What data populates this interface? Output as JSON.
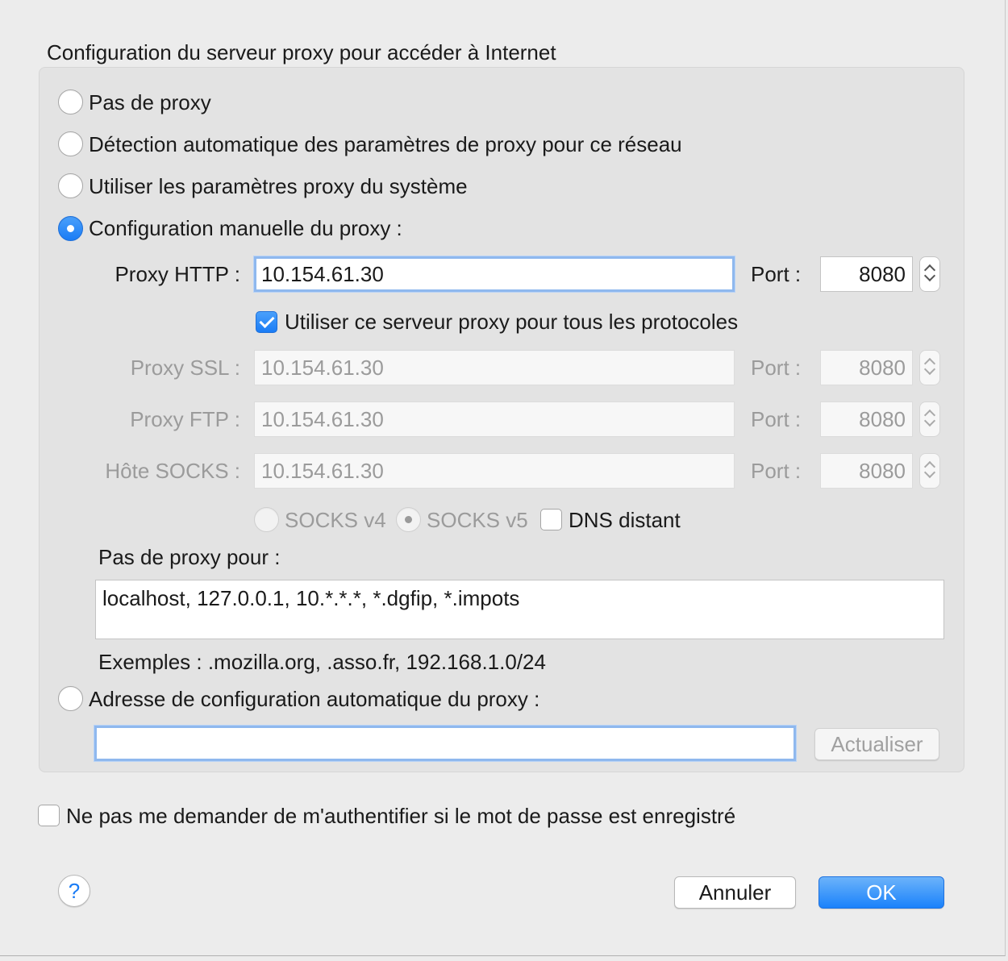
{
  "group": {
    "title": "Configuration du serveur proxy pour accéder à Internet"
  },
  "options": {
    "no_proxy": "Pas de proxy",
    "auto_detect": "Détection automatique des paramètres de proxy pour ce réseau",
    "system": "Utiliser les paramètres proxy du système",
    "manual": "Configuration manuelle du proxy :",
    "pac": "Adresse de configuration automatique du proxy :"
  },
  "selected_option": "manual",
  "http": {
    "label": "Proxy HTTP :",
    "value": "10.154.61.30",
    "port_label": "Port :",
    "port": "8080"
  },
  "use_for_all": {
    "label": "Utiliser ce serveur proxy pour tous les protocoles",
    "checked": true
  },
  "ssl": {
    "label": "Proxy SSL :",
    "value": "10.154.61.30",
    "port_label": "Port :",
    "port": "8080"
  },
  "ftp": {
    "label": "Proxy FTP :",
    "value": "10.154.61.30",
    "port_label": "Port :",
    "port": "8080"
  },
  "socks": {
    "label": "Hôte SOCKS :",
    "value": "10.154.61.30",
    "port_label": "Port :",
    "port": "8080"
  },
  "socks_version": {
    "v4": "SOCKS v4",
    "v5": "SOCKS v5",
    "selected": "v5"
  },
  "remote_dns": {
    "label": "DNS distant",
    "checked": false
  },
  "no_proxy_for": {
    "label": "Pas de proxy pour :",
    "value": "localhost, 127.0.0.1, 10.*.*.*, *.dgfip, *.impots"
  },
  "examples": "Exemples : .mozilla.org, .asso.fr, 192.168.1.0/24",
  "pac_url": {
    "value": "",
    "reload_label": "Actualiser"
  },
  "no_auth_prompt": {
    "label": "Ne pas me demander de m'authentifier si le mot de passe est enregistré",
    "checked": false
  },
  "footer": {
    "help_label": "?",
    "cancel_label": "Annuler",
    "ok_label": "OK"
  },
  "colors": {
    "accent": "#1a82fb",
    "dialog_bg": "#ececec",
    "group_bg": "#e3e3e3"
  }
}
